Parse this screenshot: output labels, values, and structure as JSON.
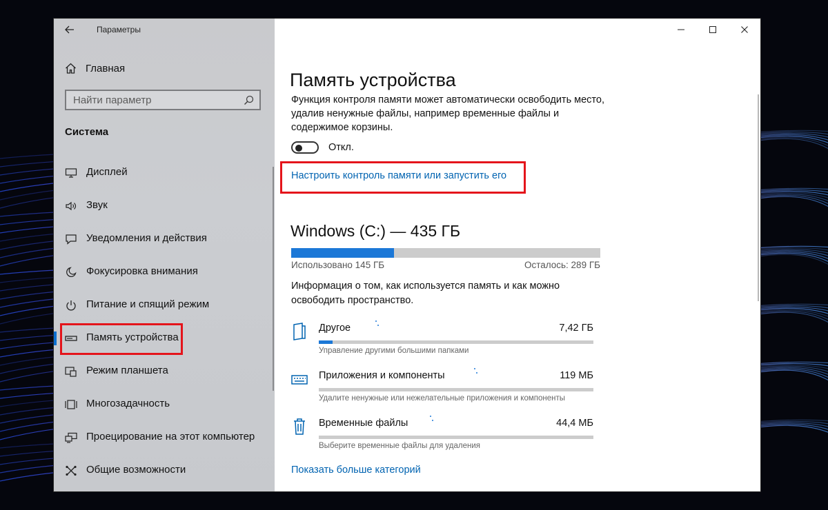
{
  "window": {
    "title": "Параметры"
  },
  "sidebar": {
    "home_label": "Главная",
    "search_placeholder": "Найти параметр",
    "section_label": "Система",
    "items": [
      {
        "label": "Дисплей",
        "icon": "display-icon"
      },
      {
        "label": "Звук",
        "icon": "speaker-icon"
      },
      {
        "label": "Уведомления и действия",
        "icon": "notification-icon"
      },
      {
        "label": "Фокусировка внимания",
        "icon": "moon-icon"
      },
      {
        "label": "Питание и спящий режим",
        "icon": "power-icon"
      },
      {
        "label": "Память устройства",
        "icon": "storage-icon",
        "active": true
      },
      {
        "label": "Режим планшета",
        "icon": "tablet-icon"
      },
      {
        "label": "Многозадачность",
        "icon": "multitask-icon"
      },
      {
        "label": "Проецирование на этот компьютер",
        "icon": "projection-icon"
      },
      {
        "label": "Общие возможности",
        "icon": "shared-icon"
      }
    ]
  },
  "main": {
    "title": "Память устройства",
    "description": "Функция контроля памяти может автоматически освободить место, удалив ненужные файлы, например временные файлы и содержимое корзины.",
    "toggle": {
      "state": "off",
      "label": "Откл."
    },
    "config_link": "Настроить контроль памяти или запустить его",
    "drive": {
      "title": "Windows (C:) — 435 ГБ",
      "used_label": "Использовано 145 ГБ",
      "free_label": "Осталось: 289 ГБ",
      "used_fraction": 0.333
    },
    "info_text": "Информация о том, как используется память и как можно освободить пространство.",
    "categories": [
      {
        "name": "Другое",
        "size": "7,42 ГБ",
        "sub": "Управление другими большими папками",
        "fraction": 0.05,
        "icon": "folder-icon"
      },
      {
        "name": "Приложения и компоненты",
        "size": "119 МБ",
        "sub": "Удалите ненужные или нежелательные приложения и компоненты",
        "fraction": 0.0,
        "icon": "keyboard-icon"
      },
      {
        "name": "Временные файлы",
        "size": "44,4 МБ",
        "sub": "Выберите временные файлы для удаления",
        "fraction": 0.0,
        "icon": "trash-icon"
      }
    ],
    "more_link": "Показать больше категорий"
  },
  "colors": {
    "accent": "#0063b1",
    "bar_fill": "#1c78d7",
    "bar_track": "#cccccc",
    "highlight": "#e4141b"
  }
}
